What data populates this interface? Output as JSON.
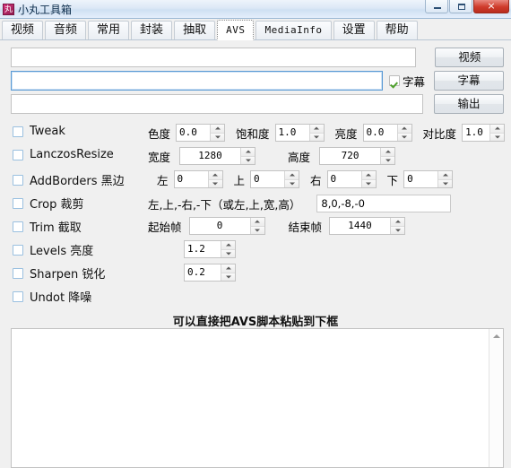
{
  "window": {
    "title": "小丸工具箱",
    "icon": "app-icon-wan",
    "icon_glyph": "丸",
    "buttons": {
      "minimize": "minimize-icon",
      "maximize": "maximize-icon",
      "close": "×"
    }
  },
  "tabs": [
    {
      "label": "视频",
      "active": false,
      "mono": false
    },
    {
      "label": "音频",
      "active": false,
      "mono": false
    },
    {
      "label": "常用",
      "active": false,
      "mono": false
    },
    {
      "label": "封装",
      "active": false,
      "mono": false
    },
    {
      "label": "抽取",
      "active": false,
      "mono": false
    },
    {
      "label": "AVS",
      "active": true,
      "mono": true
    },
    {
      "label": "MediaInfo",
      "active": false,
      "mono": true
    },
    {
      "label": "设置",
      "active": false,
      "mono": false
    },
    {
      "label": "帮助",
      "active": false,
      "mono": false
    }
  ],
  "paths": {
    "video": {
      "value": "",
      "placeholder": ""
    },
    "subtitle": {
      "value": "",
      "placeholder": ""
    },
    "output": {
      "value": "",
      "placeholder": ""
    },
    "subtitle_checkbox": {
      "label": "字幕",
      "checked": true
    },
    "buttons": {
      "video": "视频",
      "subtitle": "字幕",
      "output": "输出"
    }
  },
  "options": [
    {
      "name": "tweak",
      "label": "Tweak",
      "checked": false
    },
    {
      "name": "lanczos-resize",
      "label": "LanczosResize",
      "checked": false
    },
    {
      "name": "add-borders",
      "label": "AddBorders 黑边",
      "checked": false
    },
    {
      "name": "crop",
      "label": "Crop 裁剪",
      "checked": false
    },
    {
      "name": "trim",
      "label": "Trim 截取",
      "checked": false
    },
    {
      "name": "levels",
      "label": "Levels 亮度",
      "checked": false
    },
    {
      "name": "sharpen",
      "label": "Sharpen 锐化",
      "checked": false
    },
    {
      "name": "undot",
      "label": "Undot 降噪",
      "checked": false
    }
  ],
  "tweak": {
    "hue_label": "色度",
    "hue_value": "0.0",
    "sat_label": "饱和度",
    "sat_value": "1.0",
    "bright_label": "亮度",
    "bright_value": "0.0",
    "contrast_label": "对比度",
    "contrast_value": "1.0"
  },
  "resize": {
    "width_label": "宽度",
    "width_value": "1280",
    "height_label": "高度",
    "height_value": "720"
  },
  "borders": {
    "left_label": "左",
    "left_value": "0",
    "top_label": "上",
    "top_value": "0",
    "right_label": "右",
    "right_value": "0",
    "bottom_label": "下",
    "bottom_value": "0"
  },
  "crop": {
    "hint": "左,上,-右,-下（或左,上,宽,高）",
    "value": "8,0,-8,-0"
  },
  "trim": {
    "start_label": "起始帧",
    "start_value": "0",
    "end_label": "结束帧",
    "end_value": "1440"
  },
  "levels": {
    "value": "1.2"
  },
  "sharpen": {
    "value": "0.2"
  },
  "script": {
    "hint": "可以直接把AVS脚本粘贴到下框",
    "value": "",
    "placeholder": ""
  }
}
